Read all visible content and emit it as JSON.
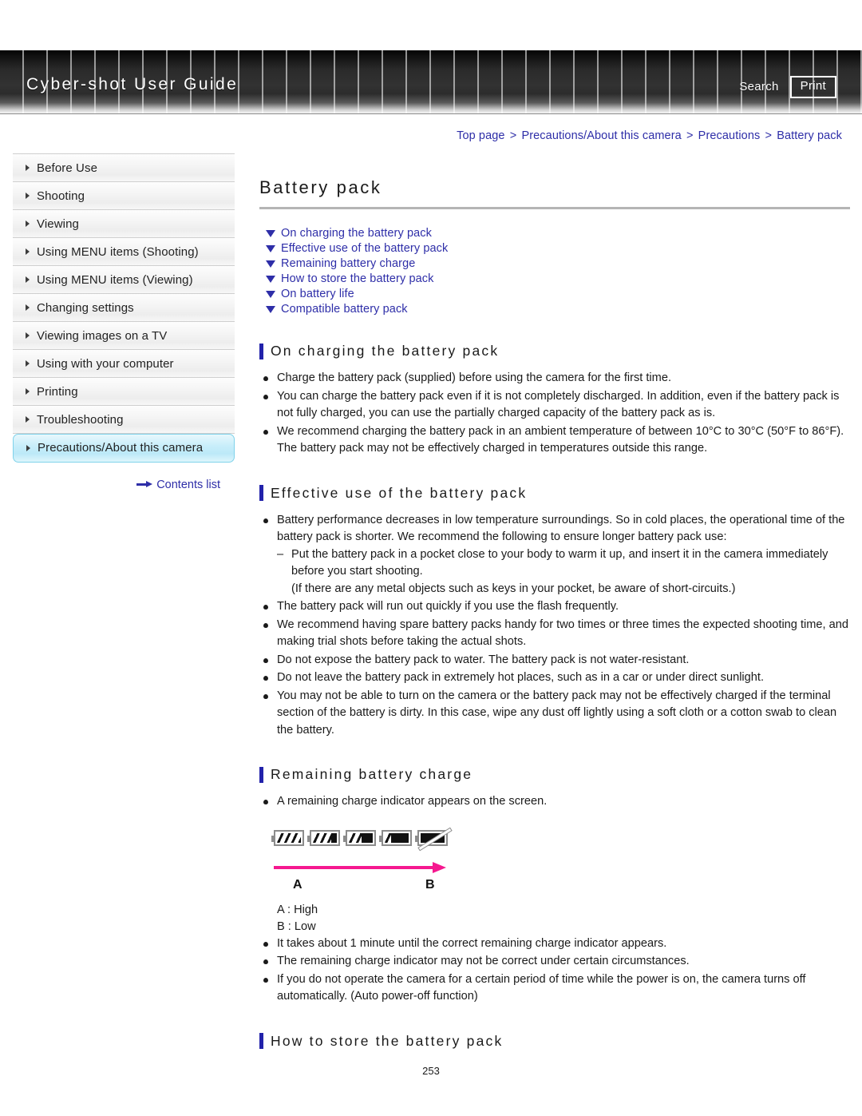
{
  "header": {
    "brand": "Cyber-shot User Guide",
    "search_label": "Search",
    "print_label": "Print"
  },
  "breadcrumb": {
    "items": [
      "Top page",
      "Precautions/About this camera",
      "Precautions",
      "Battery pack"
    ],
    "separator": ">"
  },
  "sidebar": {
    "items": [
      {
        "label": "Before Use",
        "active": false
      },
      {
        "label": "Shooting",
        "active": false
      },
      {
        "label": "Viewing",
        "active": false
      },
      {
        "label": "Using MENU items (Shooting)",
        "active": false
      },
      {
        "label": "Using MENU items (Viewing)",
        "active": false
      },
      {
        "label": "Changing settings",
        "active": false
      },
      {
        "label": "Viewing images on a TV",
        "active": false
      },
      {
        "label": "Using with your computer",
        "active": false
      },
      {
        "label": "Printing",
        "active": false
      },
      {
        "label": "Troubleshooting",
        "active": false
      },
      {
        "label": "Precautions/About this camera",
        "active": true
      }
    ],
    "contents_link": "Contents list"
  },
  "main": {
    "title": "Battery pack",
    "jump_links": [
      "On charging the battery pack",
      "Effective use of the battery pack",
      "Remaining battery charge",
      "How to store the battery pack",
      "On battery life",
      "Compatible battery pack"
    ],
    "sections": {
      "charging": {
        "heading": "On charging the battery pack",
        "bullets": [
          "Charge the battery pack (supplied) before using the camera for the first time.",
          "You can charge the battery pack even if it is not completely discharged. In addition, even if the battery pack is not fully charged, you can use the partially charged capacity of the battery pack as is.",
          "We recommend charging the battery pack in an ambient temperature of between 10°C to 30°C (50°F to 86°F). The battery pack may not be effectively charged in temperatures outside this range."
        ]
      },
      "effective": {
        "heading": "Effective use of the battery pack",
        "bullet1": "Battery performance decreases in low temperature surroundings. So in cold places, the operational time of the battery pack is shorter. We recommend the following to ensure longer battery pack use:",
        "sub1": "Put the battery pack in a pocket close to your body to warm it up, and insert it in the camera immediately before you start shooting.",
        "sub1_note": "(If there are any metal objects such as keys in your pocket, be aware of short-circuits.)",
        "bullets_rest": [
          "The battery pack will run out quickly if you use the flash frequently.",
          "We recommend having spare battery packs handy for two times or three times the expected shooting time, and making trial shots before taking the actual shots.",
          "Do not expose the battery pack to water. The battery pack is not water-resistant.",
          "Do not leave the battery pack in extremely hot places, such as in a car or under direct sunlight.",
          "You may not be able to turn on the camera or the battery pack may not be effectively charged if the terminal section of the battery is dirty. In this case, wipe any dust off lightly using a soft cloth or a cotton swab to clean the battery."
        ]
      },
      "remaining": {
        "heading": "Remaining battery charge",
        "intro_bullet": "A remaining charge indicator appears on the screen.",
        "figure": {
          "levels": [
            4,
            3,
            2,
            1,
            0
          ],
          "label_a": "A",
          "label_b": "B",
          "legend_a": "A : High",
          "legend_b": "B : Low",
          "arrow_color": "#f5188f"
        },
        "bullets": [
          "It takes about 1 minute until the correct remaining charge indicator appears.",
          "The remaining charge indicator may not be correct under certain circumstances.",
          "If you do not operate the camera for a certain period of time while the power is on, the camera turns off automatically. (Auto power-off function)"
        ]
      },
      "store": {
        "heading": "How to store the battery pack"
      }
    }
  },
  "footer": {
    "page_number": "253"
  }
}
